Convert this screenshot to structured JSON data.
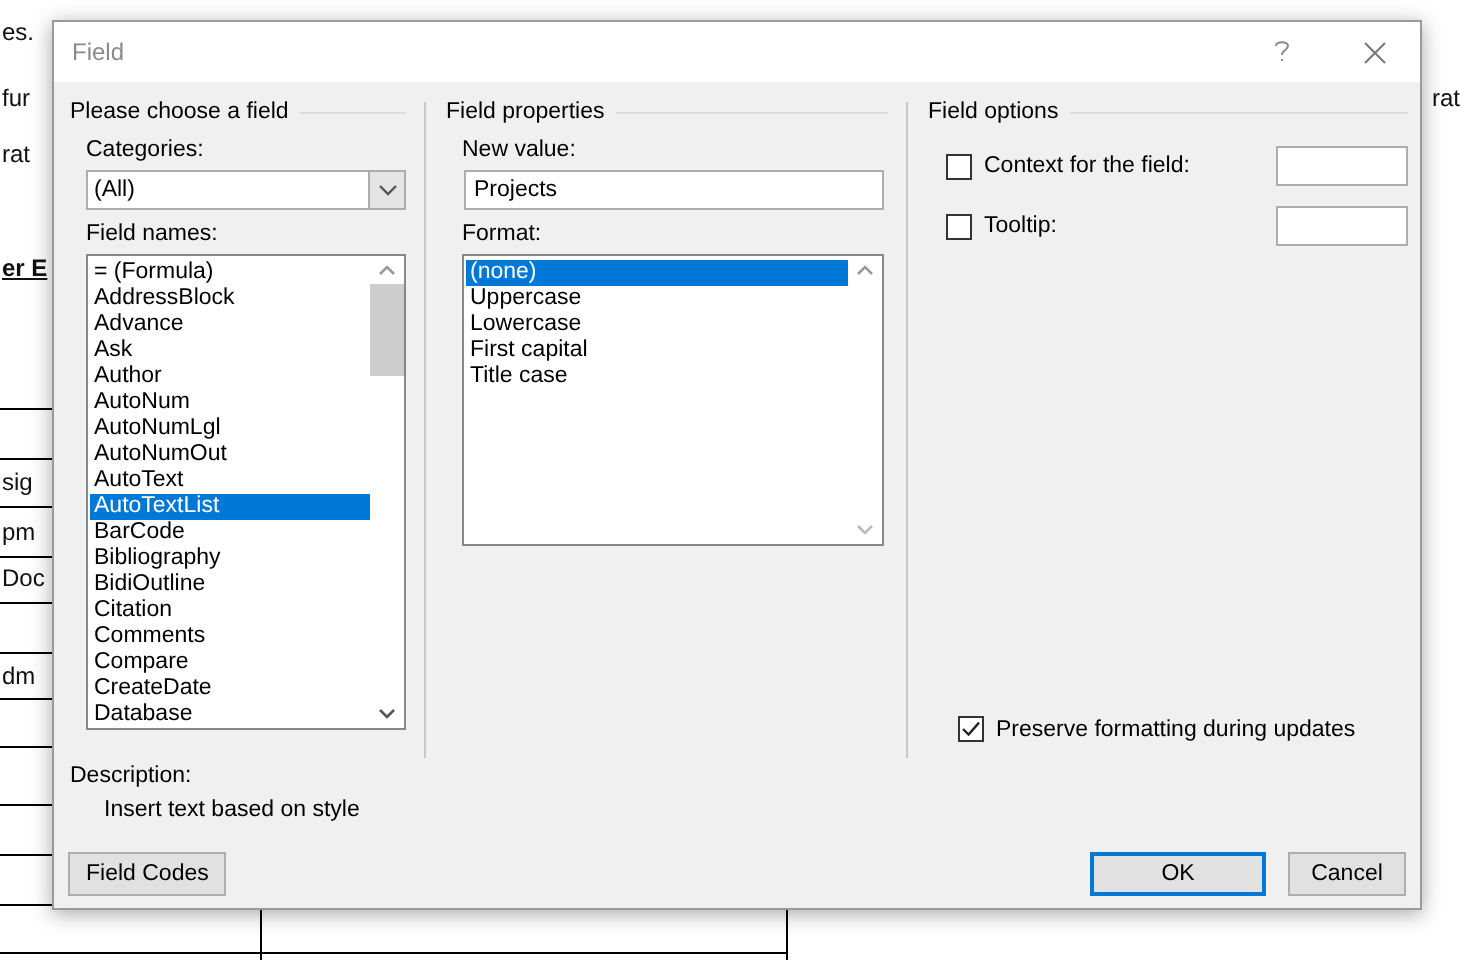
{
  "document": {
    "left_fragments": [
      {
        "text": "es.",
        "kind": "text"
      },
      {
        "text": "fur",
        "kind": "text"
      },
      {
        "text": "rat",
        "kind": "text"
      },
      {
        "text": "er E",
        "kind": "heading"
      },
      {
        "text": "sig",
        "kind": "text"
      },
      {
        "text": "pm",
        "kind": "text"
      },
      {
        "text": "Doc",
        "kind": "text"
      },
      {
        "text": "dm",
        "kind": "text"
      }
    ],
    "right_fragments": [
      {
        "text": "rat",
        "kind": "text"
      }
    ]
  },
  "window": {
    "title": "Field"
  },
  "choose_group": {
    "title": "Please choose a field",
    "categories_label": "Categories:",
    "categories_value": "(All)",
    "field_names_label": "Field names:",
    "field_names": [
      {
        "label": "= (Formula)",
        "selected": false
      },
      {
        "label": "AddressBlock",
        "selected": false
      },
      {
        "label": "Advance",
        "selected": false
      },
      {
        "label": "Ask",
        "selected": false
      },
      {
        "label": "Author",
        "selected": false
      },
      {
        "label": "AutoNum",
        "selected": false
      },
      {
        "label": "AutoNumLgl",
        "selected": false
      },
      {
        "label": "AutoNumOut",
        "selected": false
      },
      {
        "label": "AutoText",
        "selected": false
      },
      {
        "label": "AutoTextList",
        "selected": true
      },
      {
        "label": "BarCode",
        "selected": false
      },
      {
        "label": "Bibliography",
        "selected": false
      },
      {
        "label": "BidiOutline",
        "selected": false
      },
      {
        "label": "Citation",
        "selected": false
      },
      {
        "label": "Comments",
        "selected": false
      },
      {
        "label": "Compare",
        "selected": false
      },
      {
        "label": "CreateDate",
        "selected": false
      },
      {
        "label": "Database",
        "selected": false
      }
    ]
  },
  "properties_group": {
    "title": "Field properties",
    "new_value_label": "New value:",
    "new_value": "Projects",
    "format_label": "Format:",
    "formats": [
      {
        "label": "(none)",
        "selected": true
      },
      {
        "label": "Uppercase",
        "selected": false
      },
      {
        "label": "Lowercase",
        "selected": false
      },
      {
        "label": "First capital",
        "selected": false
      },
      {
        "label": "Title case",
        "selected": false
      }
    ]
  },
  "options_group": {
    "title": "Field options",
    "options": [
      {
        "label": "Context for the field:",
        "checked": false,
        "kind": "with_field"
      },
      {
        "label": "Tooltip:",
        "checked": false,
        "kind": "with_field"
      }
    ],
    "preserve_formatting": {
      "label": "Preserve formatting during updates",
      "checked": true
    }
  },
  "description": {
    "label": "Description:",
    "text": "Insert text based on style"
  },
  "buttons": [
    {
      "label": "Field Codes",
      "kind": "secondary"
    },
    {
      "label": "OK",
      "kind": "default"
    },
    {
      "label": "Cancel",
      "kind": "secondary"
    }
  ]
}
